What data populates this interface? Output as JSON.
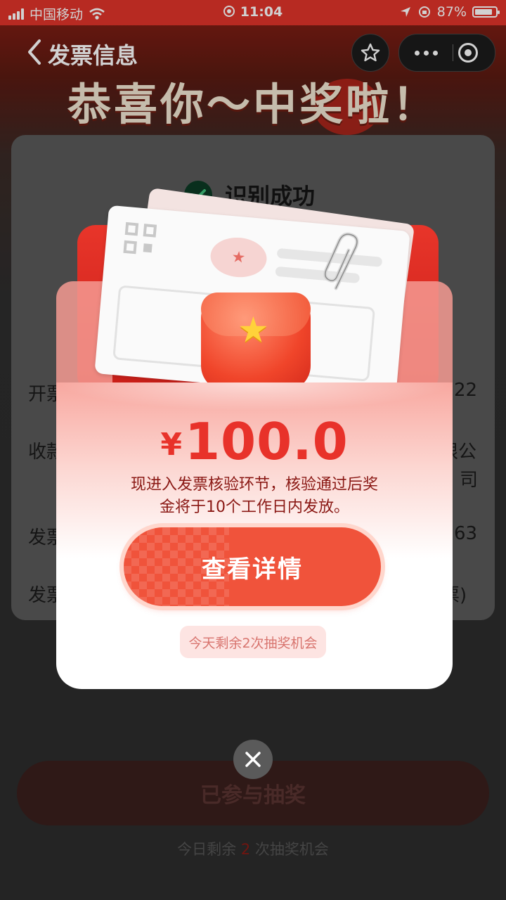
{
  "status_bar": {
    "carrier": "中国移动",
    "time": "11:04",
    "battery_text": "87%",
    "battery_level": 0.87
  },
  "nav": {
    "title": "发票信息"
  },
  "headline": "恭喜你～中奖啦！",
  "info_card": {
    "success_text": "识别成功",
    "row_fragments": [
      {
        "left": "开票",
        "right": "22"
      },
      {
        "left": "收款",
        "right": "限公"
      },
      {
        "left": "",
        "right": "司"
      },
      {
        "left": "发票",
        "right": "63"
      },
      {
        "left": "发票",
        "right": "票)"
      }
    ]
  },
  "modal": {
    "currency_symbol": "¥",
    "amount": "100.0",
    "description_line1": "现进入发票核验环节，核验通过后奖",
    "description_line2": "金将于10个工作日内发放。",
    "detail_button": "查看详情",
    "chance_text": "今天剩余2次抽奖机会"
  },
  "bottom": {
    "button_label": "已参与抽奖",
    "hint_prefix": "今日剩余 ",
    "hint_count": "2",
    "hint_suffix": " 次抽奖机会"
  },
  "colors": {
    "accent_red": "#e8322a",
    "status_bar": "#e0342a",
    "success_green": "#0b3a24"
  },
  "icons": [
    "signal-icon",
    "wifi-icon",
    "location-icon",
    "lock-rotation-icon",
    "battery-icon",
    "back-chevron-icon",
    "star-icon",
    "more-dots-icon",
    "target-close-icon",
    "check-icon",
    "close-icon"
  ]
}
